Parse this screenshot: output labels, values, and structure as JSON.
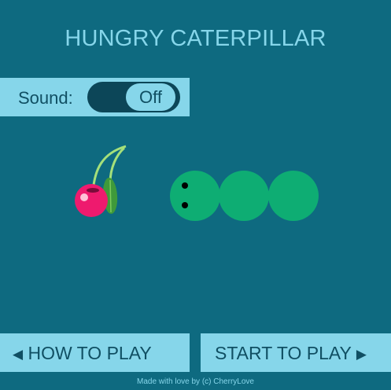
{
  "title": "HUNGRY CATERPILLAR",
  "sound": {
    "label": "Sound:",
    "toggle_value": "Off"
  },
  "buttons": {
    "how_to_play": {
      "arrow": "◀",
      "label": "HOW TO PLAY"
    },
    "start_to_play": {
      "arrow": "▶",
      "label": "START TO PLAY"
    }
  },
  "footer": "Made with love by (c) CherryLove",
  "colors": {
    "background": "#0e6a80",
    "panel": "#86d6ea",
    "caterpillar": "#0ead73",
    "cherry": "#ee1a6e"
  },
  "scene": {
    "caterpillar_segments": 3,
    "food": "cherry"
  }
}
